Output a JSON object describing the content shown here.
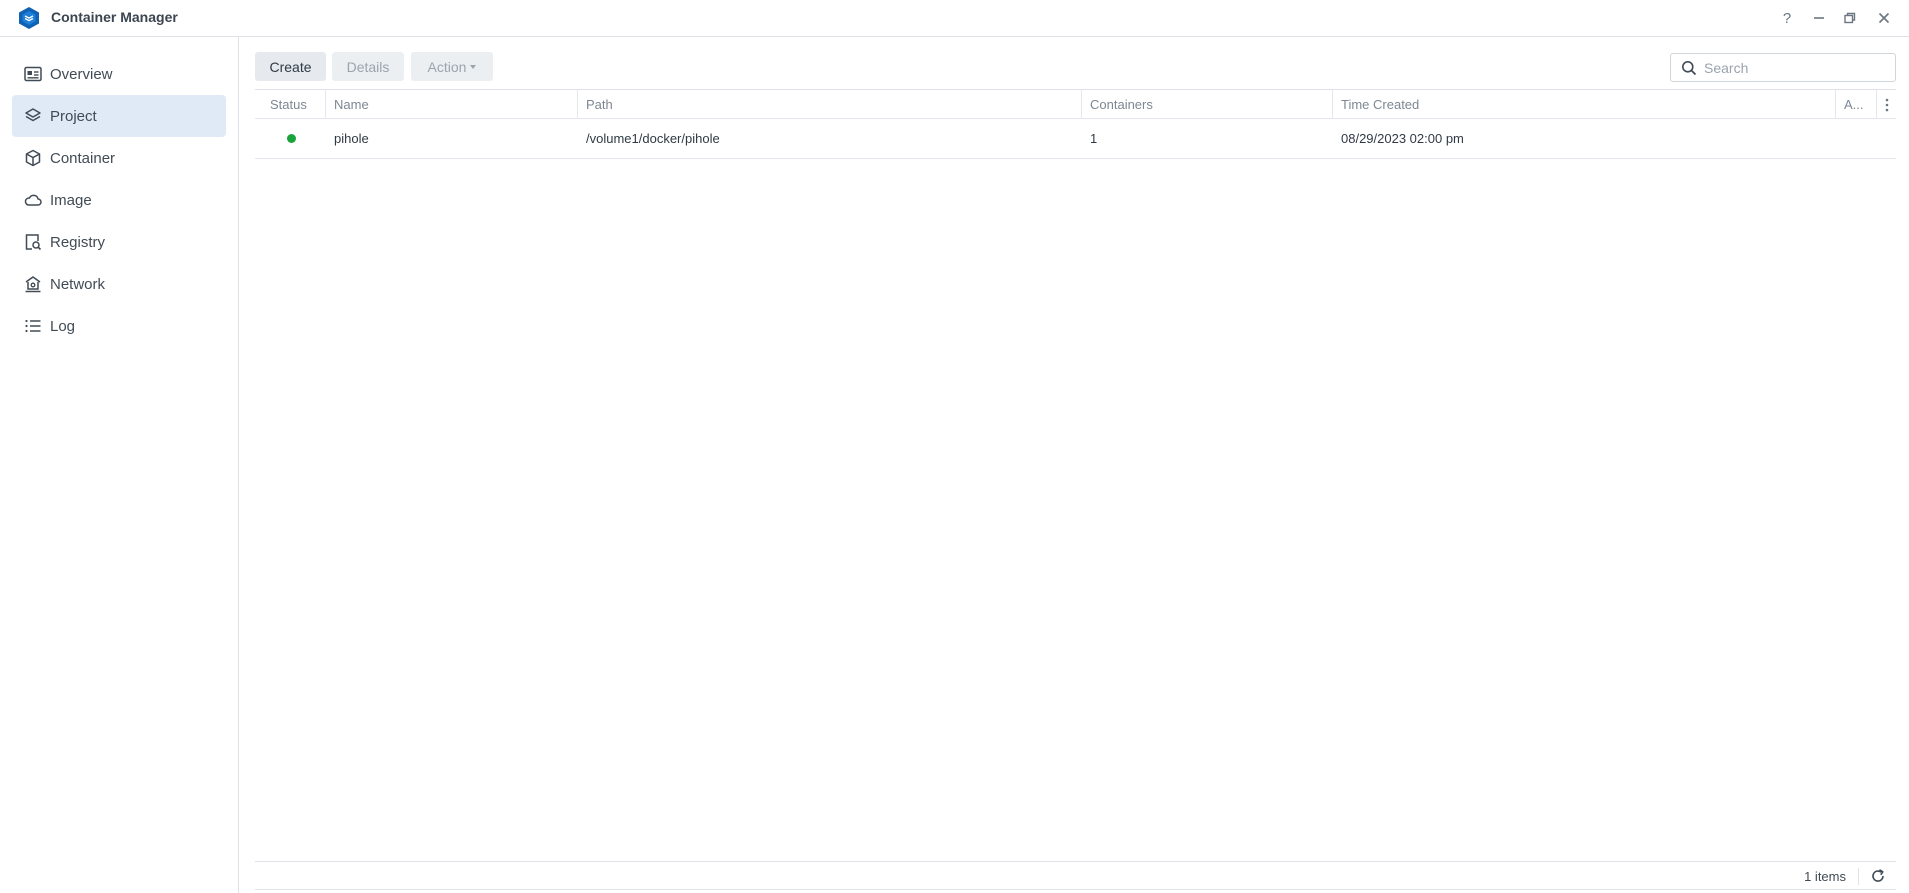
{
  "window": {
    "title": "Container Manager",
    "controls": [
      "help-icon",
      "minimize-icon",
      "restore-icon",
      "close-icon"
    ],
    "help_glyph": "?"
  },
  "sidebar": {
    "items": [
      {
        "label": "Overview",
        "icon": "overview-icon",
        "active": false
      },
      {
        "label": "Project",
        "icon": "project-layers-icon",
        "active": true
      },
      {
        "label": "Container",
        "icon": "container-cube-icon",
        "active": false
      },
      {
        "label": "Image",
        "icon": "cloud-icon",
        "active": false
      },
      {
        "label": "Registry",
        "icon": "registry-search-icon",
        "active": false
      },
      {
        "label": "Network",
        "icon": "network-house-icon",
        "active": false
      },
      {
        "label": "Log",
        "icon": "list-icon",
        "active": false
      }
    ]
  },
  "toolbar": {
    "create_label": "Create",
    "details_label": "Details",
    "action_label": "Action",
    "search_placeholder": "Search"
  },
  "table": {
    "columns": [
      "Status",
      "Name",
      "Path",
      "Containers",
      "Time Created",
      "A..."
    ],
    "rows": [
      {
        "status": "running",
        "status_color": "#1aa33b",
        "name": "pihole",
        "path": "/volume1/docker/pihole",
        "containers": "1",
        "time_created": "08/29/2023 02:00 pm"
      }
    ],
    "footer": {
      "count_label": "1 items"
    }
  },
  "colors": {
    "accent": "#0f62b4",
    "active_nav_bg": "#dfeaf6",
    "running": "#1aa33b"
  }
}
